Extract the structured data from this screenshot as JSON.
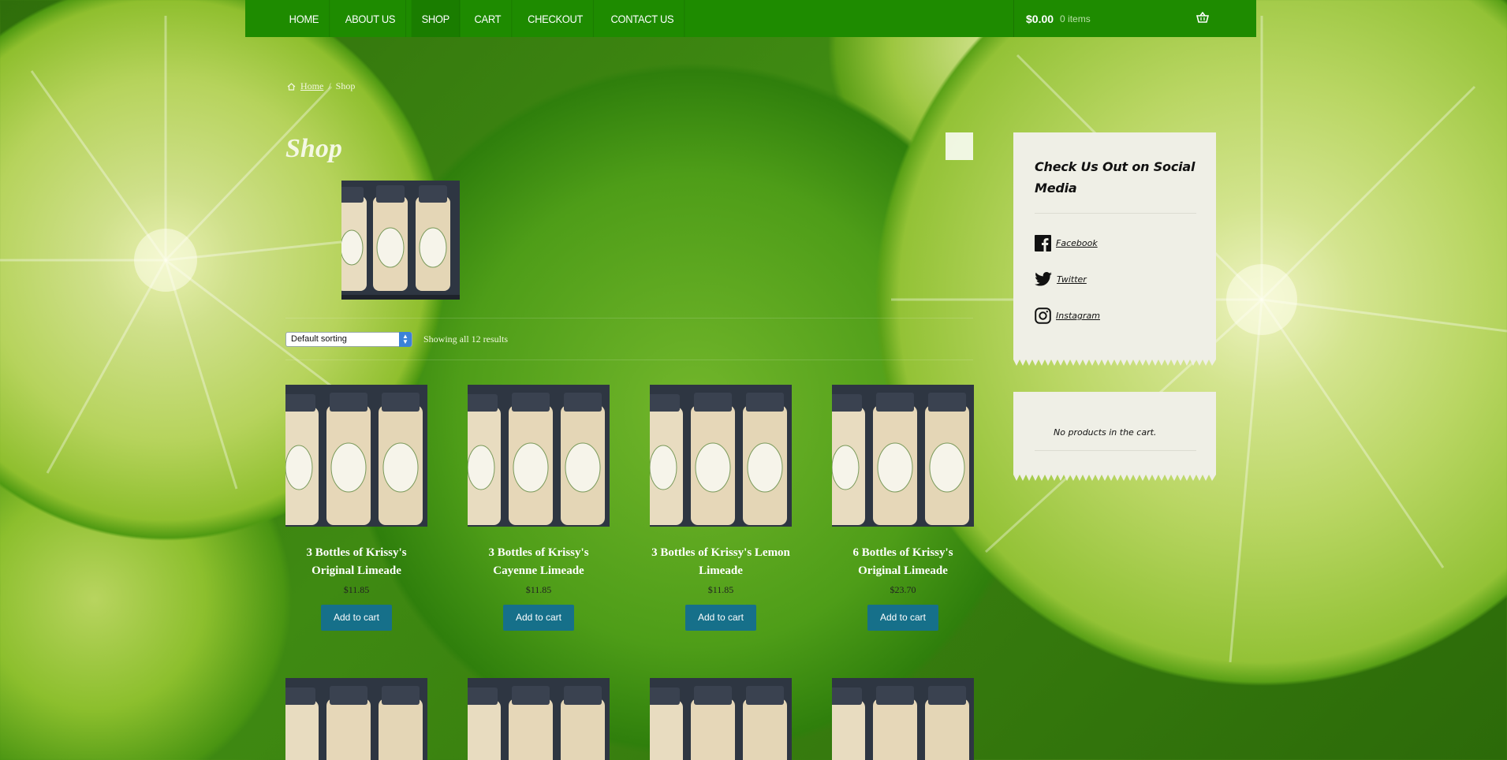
{
  "nav": {
    "items": [
      {
        "label": "HOME",
        "active": false
      },
      {
        "label": "ABOUT US",
        "active": false
      },
      {
        "label": "SHOP",
        "active": true
      },
      {
        "label": "CART",
        "active": false
      },
      {
        "label": "CHECKOUT",
        "active": false
      },
      {
        "label": "CONTACT US",
        "active": false
      }
    ],
    "cart_amount": "$0.00",
    "cart_count": "0 items"
  },
  "breadcrumb": {
    "home": "Home",
    "separator": "/",
    "current": "Shop"
  },
  "page": {
    "title": "Shop"
  },
  "sorting": {
    "selected": "Default sorting",
    "result_count": "Showing all 12 results"
  },
  "products": [
    {
      "title": "3 Bottles of Krissy's Original Limeade",
      "price": "$11.85",
      "button": "Add to cart"
    },
    {
      "title": "3 Bottles of Krissy's Cayenne Limeade",
      "price": "$11.85",
      "button": "Add to cart"
    },
    {
      "title": "3 Bottles of Krissy's Lemon Limeade",
      "price": "$11.85",
      "button": "Add to cart"
    },
    {
      "title": "6 Bottles of Krissy's Original Limeade",
      "price": "$23.70",
      "button": "Add to cart"
    }
  ],
  "sidebar": {
    "social_title": "Check Us Out on Social Media",
    "links": [
      {
        "label": "Facebook",
        "icon": "facebook-icon"
      },
      {
        "label": "Twitter",
        "icon": "twitter-icon"
      },
      {
        "label": "Instagram",
        "icon": "instagram-icon"
      }
    ],
    "cart_empty": "No products in the cart."
  },
  "colors": {
    "nav_green": "#1e8b00",
    "button_teal": "#16708a",
    "widget_bg": "#efefe6"
  }
}
